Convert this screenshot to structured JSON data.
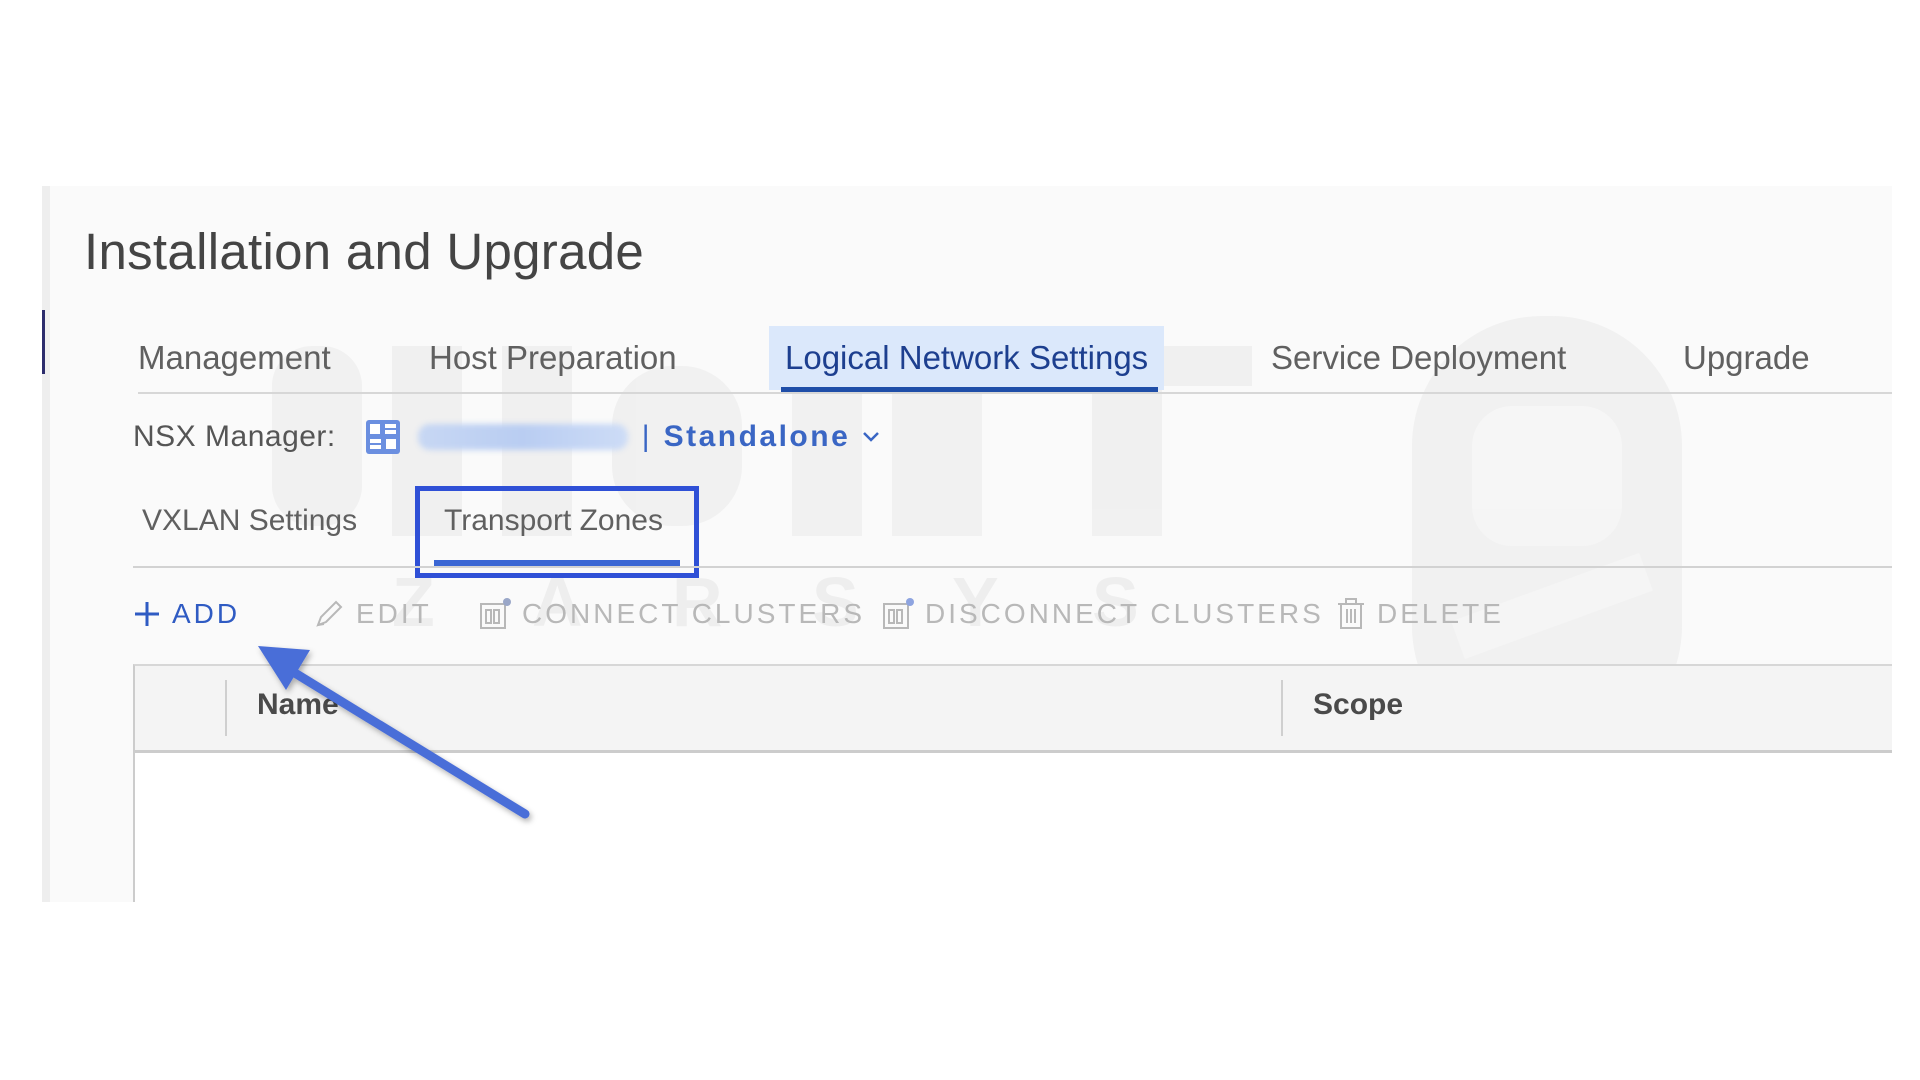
{
  "page": {
    "title": "Installation and Upgrade"
  },
  "main_tabs": [
    {
      "label": "Management",
      "active": false
    },
    {
      "label": "Host Preparation",
      "active": false
    },
    {
      "label": "Logical Network Settings",
      "active": true
    },
    {
      "label": "Service Deployment",
      "active": false
    },
    {
      "label": "Upgrade",
      "active": false
    }
  ],
  "nsx": {
    "label": "NSX Manager:",
    "separator": "|",
    "mode": "Standalone"
  },
  "sub_tabs": [
    {
      "label": "VXLAN Settings",
      "active": false
    },
    {
      "label": "Transport Zones",
      "active": true
    }
  ],
  "toolbar": {
    "add": "ADD",
    "edit": "EDIT",
    "connect": "CONNECT CLUSTERS",
    "disconnect": "DISCONNECT CLUSTERS",
    "delete": "DELETE"
  },
  "grid": {
    "columns": [
      "Name",
      "Scope"
    ],
    "rows": []
  },
  "colors": {
    "accent": "#2f5bc3",
    "active_tab_bg": "#dbe8fb",
    "highlight_box": "#2f50d6",
    "annotation_arrow": "#4a6ed8"
  },
  "icons": {
    "nsx": "nsx-manager-icon",
    "add": "plus-icon",
    "edit": "pencil-icon",
    "connect": "connect-clusters-icon",
    "disconnect": "disconnect-clusters-icon",
    "delete": "trash-icon",
    "chevron": "chevron-down-icon"
  }
}
